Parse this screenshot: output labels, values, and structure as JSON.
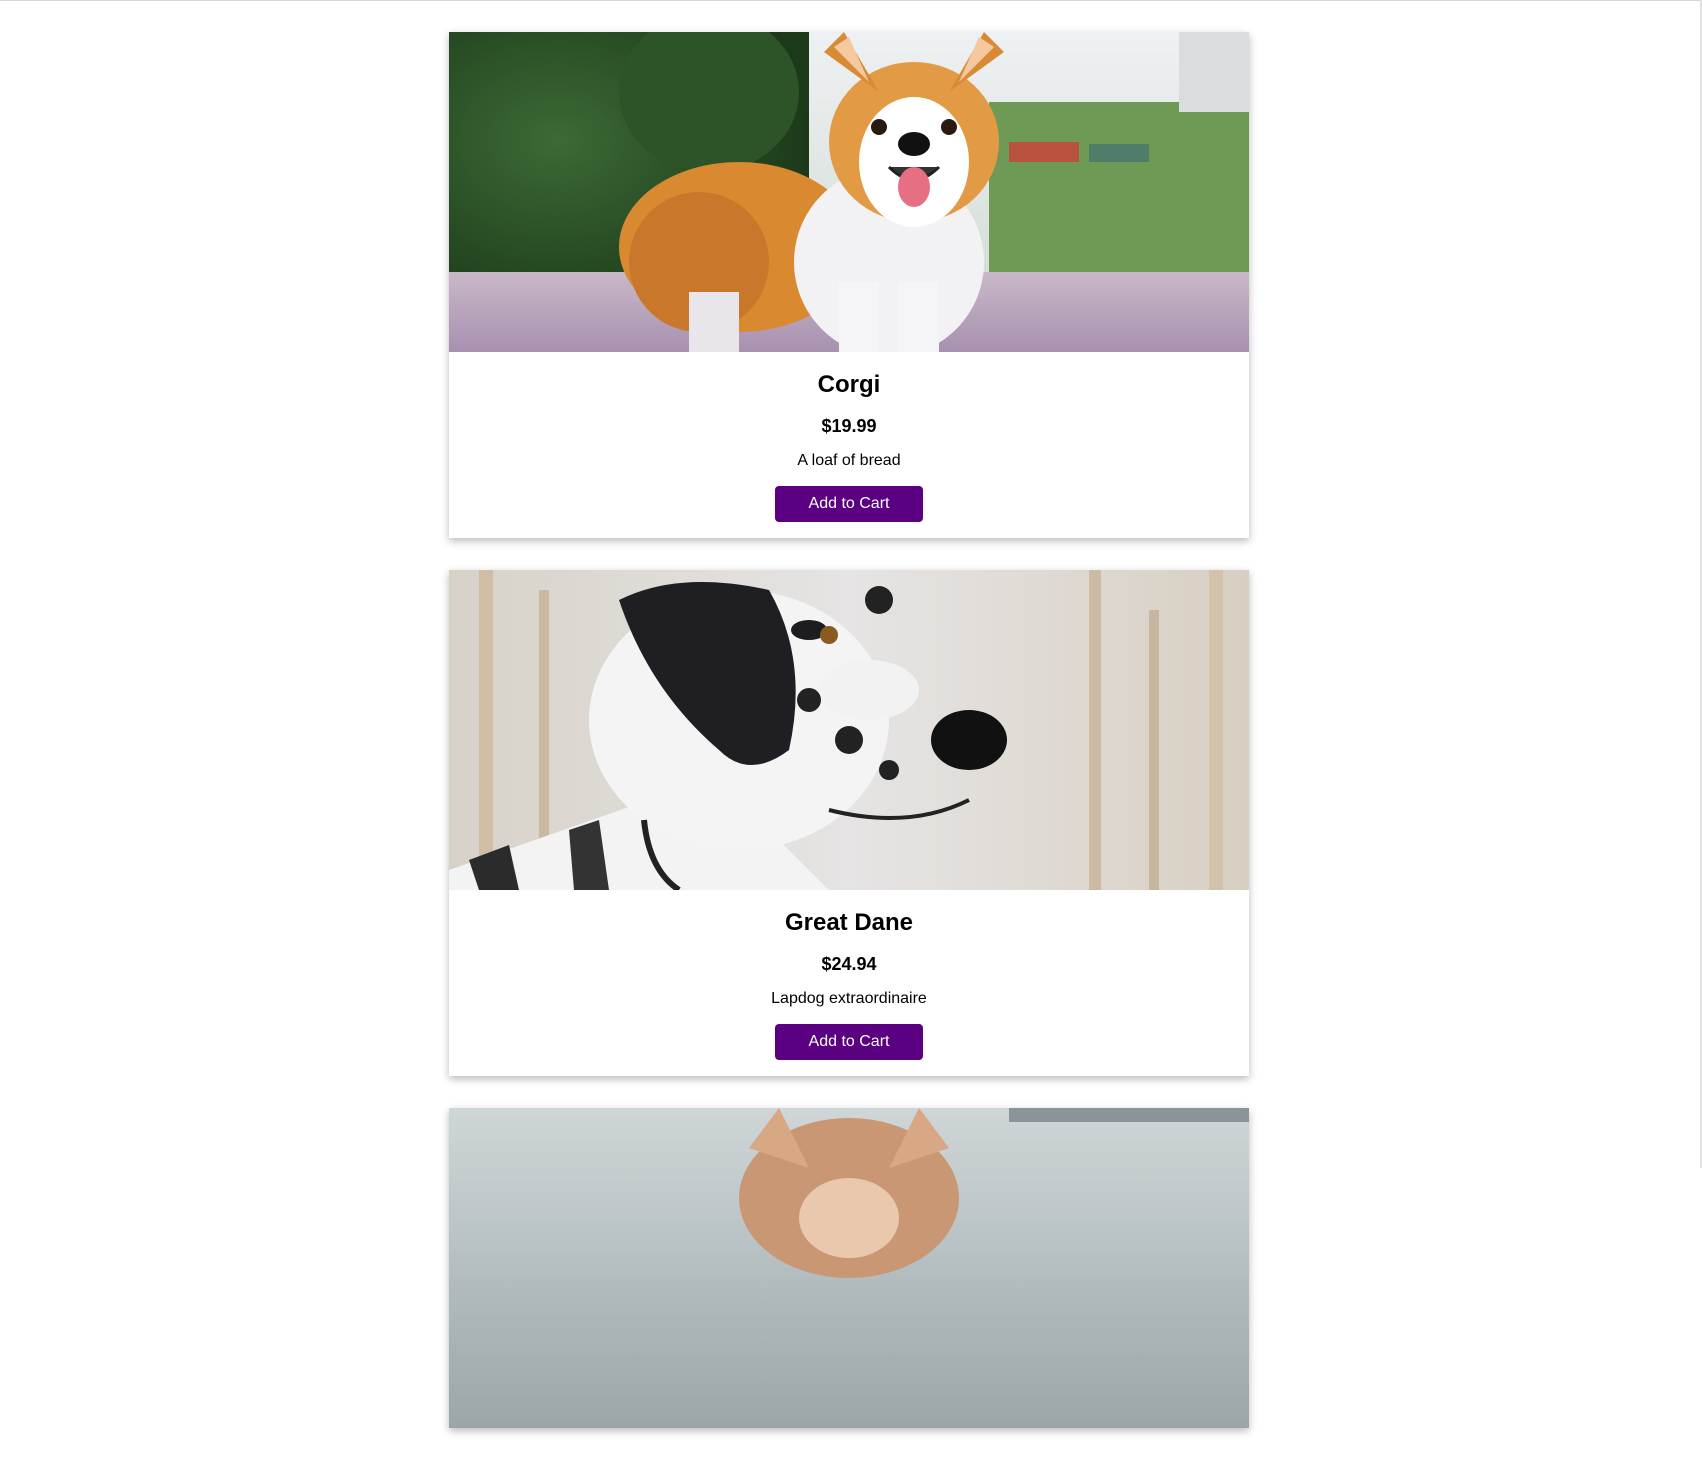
{
  "products": [
    {
      "name": "Corgi",
      "price": "$19.99",
      "description": "A loaf of bread",
      "button_label": "Add to Cart",
      "image": "corgi-photo"
    },
    {
      "name": "Great Dane",
      "price": "$24.94",
      "description": "Lapdog extraordinaire",
      "button_label": "Add to Cart",
      "image": "great-dane-photo"
    },
    {
      "image": "third-dog-photo"
    }
  ],
  "colors": {
    "button_bg": "#5a0080",
    "button_text": "#ffffff"
  }
}
